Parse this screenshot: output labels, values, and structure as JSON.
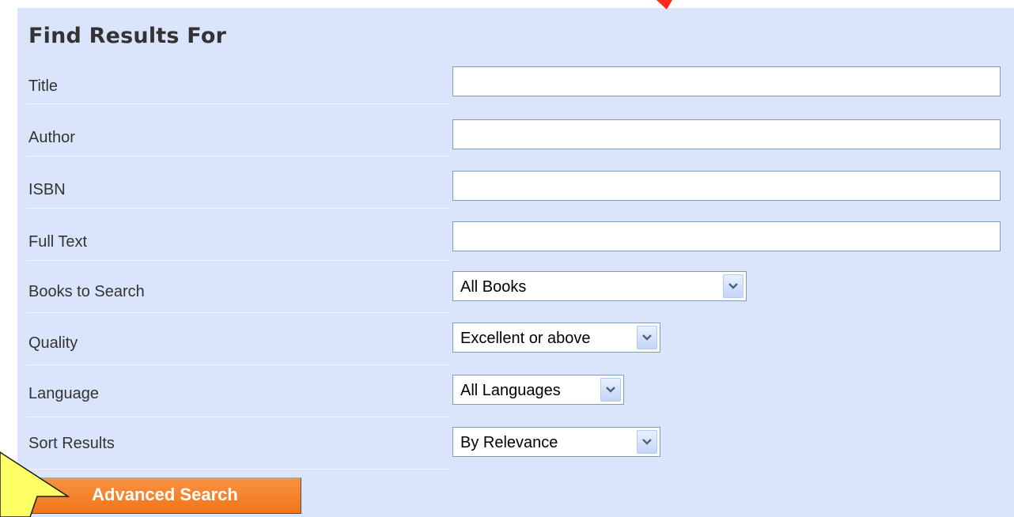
{
  "panel": {
    "title": "Find Results For"
  },
  "fields": {
    "title": {
      "label": "Title",
      "value": ""
    },
    "author": {
      "label": "Author",
      "value": ""
    },
    "isbn": {
      "label": "ISBN",
      "value": ""
    },
    "full_text": {
      "label": "Full Text",
      "value": ""
    }
  },
  "selects": {
    "books_to_search": {
      "label": "Books to Search",
      "selected": "All Books"
    },
    "quality": {
      "label": "Quality",
      "selected": "Excellent or above"
    },
    "language": {
      "label": "Language",
      "selected": "All Languages"
    },
    "sort_results": {
      "label": "Sort Results",
      "selected": "By Relevance"
    }
  },
  "actions": {
    "advanced_search": "Advanced Search"
  },
  "colors": {
    "panel_bg": "#dae5fb",
    "button_orange": "#f57f2a",
    "callout_yellow": "#ffff66",
    "arrow_red": "#ff2a1a"
  },
  "icons": {
    "select_arrow": "chevron-down-icon",
    "callout": "callout-pointer",
    "annotation_arrow": "red-arrow"
  }
}
